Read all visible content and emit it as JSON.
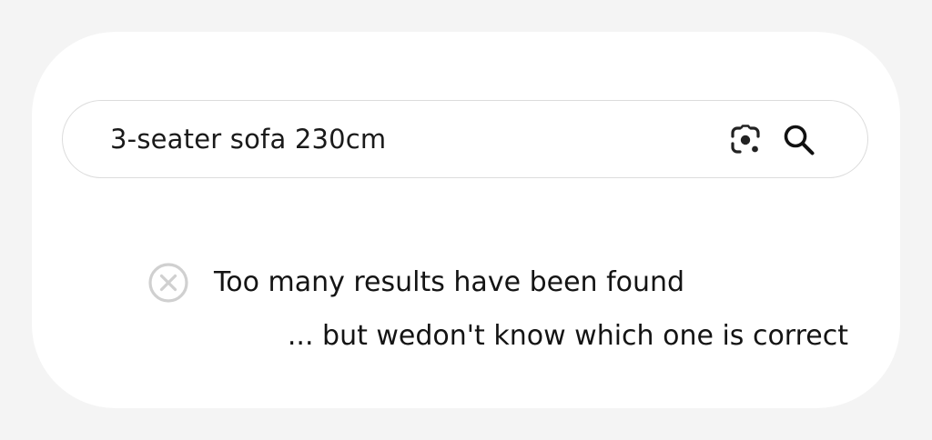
{
  "search": {
    "query": "3-seater sofa 230cm",
    "lens_icon": "camera-lens-icon",
    "search_icon": "magnifier-icon"
  },
  "status": {
    "icon": "circle-x-icon",
    "title": "Too many results have been found",
    "subtitle": "... but wedon't know which one is correct"
  },
  "colors": {
    "background": "#f4f4f4",
    "card": "#ffffff",
    "searchbar_border": "#dcdcdc",
    "icon_dark": "#222222",
    "status_icon": "#d0d0d0",
    "text": "#141414"
  }
}
